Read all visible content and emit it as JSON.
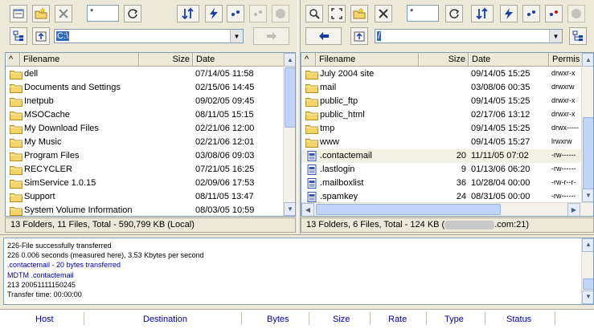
{
  "left": {
    "mask": "*",
    "path": "C:\\",
    "columns": [
      "Filename",
      "Size",
      "Date"
    ],
    "rows": [
      {
        "name": "dell",
        "size": "",
        "date": "07/14/05 11:58",
        "type": "folder"
      },
      {
        "name": "Documents and Settings",
        "size": "",
        "date": "02/15/06 14:45",
        "type": "folder"
      },
      {
        "name": "Inetpub",
        "size": "",
        "date": "09/02/05 09:45",
        "type": "folder"
      },
      {
        "name": "MSOCache",
        "size": "",
        "date": "08/11/05 15:15",
        "type": "folder"
      },
      {
        "name": "My Download Files",
        "size": "",
        "date": "02/21/06 12:00",
        "type": "folder"
      },
      {
        "name": "My Music",
        "size": "",
        "date": "02/21/06 12:01",
        "type": "folder"
      },
      {
        "name": "Program Files",
        "size": "",
        "date": "03/08/06 09:03",
        "type": "folder"
      },
      {
        "name": "RECYCLER",
        "size": "",
        "date": "07/21/05 16:25",
        "type": "folder"
      },
      {
        "name": "SimService 1.0.15",
        "size": "",
        "date": "02/09/06 17:53",
        "type": "folder"
      },
      {
        "name": "Support",
        "size": "",
        "date": "08/11/05 13:47",
        "type": "folder"
      },
      {
        "name": "System Volume Information",
        "size": "",
        "date": "08/03/05 10:59",
        "type": "folder"
      }
    ],
    "status": "13 Folders, 11 Files, Total - 590,799 KB (Local)"
  },
  "right": {
    "mask": "*",
    "path": "/",
    "columns": [
      "Filename",
      "Size",
      "Date",
      "Permis"
    ],
    "rows": [
      {
        "name": "July 2004 site",
        "size": "",
        "date": "09/14/05 15:25",
        "perm": "drwxr-x",
        "type": "folder"
      },
      {
        "name": "mail",
        "size": "",
        "date": "03/08/06 00:35",
        "perm": "drwxrw",
        "type": "folder"
      },
      {
        "name": "public_ftp",
        "size": "",
        "date": "09/14/05 15:25",
        "perm": "drwxr-x",
        "type": "folder"
      },
      {
        "name": "public_html",
        "size": "",
        "date": "02/17/06 13:12",
        "perm": "drwxr-x",
        "type": "folder"
      },
      {
        "name": "tmp",
        "size": "",
        "date": "09/14/05 15:25",
        "perm": "drwx-----",
        "type": "folder"
      },
      {
        "name": "www",
        "size": "",
        "date": "09/14/05 15:27",
        "perm": "lrwxrw",
        "type": "folder"
      },
      {
        "name": ".contactemail",
        "size": "20",
        "date": "11/11/05 07:02",
        "perm": "-rw------",
        "type": "file"
      },
      {
        "name": ".lastlogin",
        "size": "9",
        "date": "01/13/06 06:20",
        "perm": "-rw------",
        "type": "file"
      },
      {
        "name": ".mailboxlist",
        "size": "36",
        "date": "10/28/04 00:00",
        "perm": "-rw-r--r-",
        "type": "file"
      },
      {
        "name": ".spamkey",
        "size": "24",
        "date": "08/31/05 00:00",
        "perm": "-rw------",
        "type": "file"
      }
    ],
    "status_prefix": "13 Folders, 6 Files, Total - 124 KB  (",
    "status_suffix": ".com:21)"
  },
  "log": [
    {
      "text": "226-File successfully transferred",
      "color": "black"
    },
    {
      "text": "226 0.006 seconds (measured here), 3.53 Kbytes per second",
      "color": "black"
    },
    {
      "text": ".contactemail - 20 bytes transferred",
      "color": "blue"
    },
    {
      "text": "MDTM .contactemail",
      "color": "blue"
    },
    {
      "text": "213 20051111150245",
      "color": "black"
    },
    {
      "text": "Transfer time: 00:00:00",
      "color": "black"
    }
  ],
  "queue": {
    "headers": [
      "Host",
      "Destination",
      "Bytes",
      "Size",
      "Rate",
      "Type",
      "Status"
    ]
  },
  "colors": {
    "folder": "#f5d56b",
    "accent": "#0000b0"
  }
}
